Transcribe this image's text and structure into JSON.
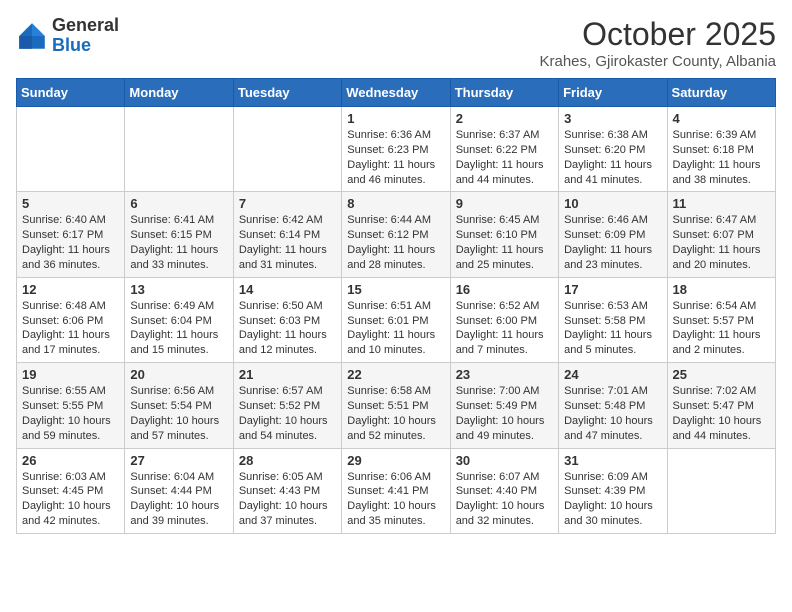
{
  "header": {
    "logo_general": "General",
    "logo_blue": "Blue",
    "month": "October 2025",
    "location": "Krahes, Gjirokaster County, Albania"
  },
  "weekdays": [
    "Sunday",
    "Monday",
    "Tuesday",
    "Wednesday",
    "Thursday",
    "Friday",
    "Saturday"
  ],
  "weeks": [
    [
      {
        "day": "",
        "info": ""
      },
      {
        "day": "",
        "info": ""
      },
      {
        "day": "",
        "info": ""
      },
      {
        "day": "1",
        "info": "Sunrise: 6:36 AM\nSunset: 6:23 PM\nDaylight: 11 hours\nand 46 minutes."
      },
      {
        "day": "2",
        "info": "Sunrise: 6:37 AM\nSunset: 6:22 PM\nDaylight: 11 hours\nand 44 minutes."
      },
      {
        "day": "3",
        "info": "Sunrise: 6:38 AM\nSunset: 6:20 PM\nDaylight: 11 hours\nand 41 minutes."
      },
      {
        "day": "4",
        "info": "Sunrise: 6:39 AM\nSunset: 6:18 PM\nDaylight: 11 hours\nand 38 minutes."
      }
    ],
    [
      {
        "day": "5",
        "info": "Sunrise: 6:40 AM\nSunset: 6:17 PM\nDaylight: 11 hours\nand 36 minutes."
      },
      {
        "day": "6",
        "info": "Sunrise: 6:41 AM\nSunset: 6:15 PM\nDaylight: 11 hours\nand 33 minutes."
      },
      {
        "day": "7",
        "info": "Sunrise: 6:42 AM\nSunset: 6:14 PM\nDaylight: 11 hours\nand 31 minutes."
      },
      {
        "day": "8",
        "info": "Sunrise: 6:44 AM\nSunset: 6:12 PM\nDaylight: 11 hours\nand 28 minutes."
      },
      {
        "day": "9",
        "info": "Sunrise: 6:45 AM\nSunset: 6:10 PM\nDaylight: 11 hours\nand 25 minutes."
      },
      {
        "day": "10",
        "info": "Sunrise: 6:46 AM\nSunset: 6:09 PM\nDaylight: 11 hours\nand 23 minutes."
      },
      {
        "day": "11",
        "info": "Sunrise: 6:47 AM\nSunset: 6:07 PM\nDaylight: 11 hours\nand 20 minutes."
      }
    ],
    [
      {
        "day": "12",
        "info": "Sunrise: 6:48 AM\nSunset: 6:06 PM\nDaylight: 11 hours\nand 17 minutes."
      },
      {
        "day": "13",
        "info": "Sunrise: 6:49 AM\nSunset: 6:04 PM\nDaylight: 11 hours\nand 15 minutes."
      },
      {
        "day": "14",
        "info": "Sunrise: 6:50 AM\nSunset: 6:03 PM\nDaylight: 11 hours\nand 12 minutes."
      },
      {
        "day": "15",
        "info": "Sunrise: 6:51 AM\nSunset: 6:01 PM\nDaylight: 11 hours\nand 10 minutes."
      },
      {
        "day": "16",
        "info": "Sunrise: 6:52 AM\nSunset: 6:00 PM\nDaylight: 11 hours\nand 7 minutes."
      },
      {
        "day": "17",
        "info": "Sunrise: 6:53 AM\nSunset: 5:58 PM\nDaylight: 11 hours\nand 5 minutes."
      },
      {
        "day": "18",
        "info": "Sunrise: 6:54 AM\nSunset: 5:57 PM\nDaylight: 11 hours\nand 2 minutes."
      }
    ],
    [
      {
        "day": "19",
        "info": "Sunrise: 6:55 AM\nSunset: 5:55 PM\nDaylight: 10 hours\nand 59 minutes."
      },
      {
        "day": "20",
        "info": "Sunrise: 6:56 AM\nSunset: 5:54 PM\nDaylight: 10 hours\nand 57 minutes."
      },
      {
        "day": "21",
        "info": "Sunrise: 6:57 AM\nSunset: 5:52 PM\nDaylight: 10 hours\nand 54 minutes."
      },
      {
        "day": "22",
        "info": "Sunrise: 6:58 AM\nSunset: 5:51 PM\nDaylight: 10 hours\nand 52 minutes."
      },
      {
        "day": "23",
        "info": "Sunrise: 7:00 AM\nSunset: 5:49 PM\nDaylight: 10 hours\nand 49 minutes."
      },
      {
        "day": "24",
        "info": "Sunrise: 7:01 AM\nSunset: 5:48 PM\nDaylight: 10 hours\nand 47 minutes."
      },
      {
        "day": "25",
        "info": "Sunrise: 7:02 AM\nSunset: 5:47 PM\nDaylight: 10 hours\nand 44 minutes."
      }
    ],
    [
      {
        "day": "26",
        "info": "Sunrise: 6:03 AM\nSunset: 4:45 PM\nDaylight: 10 hours\nand 42 minutes."
      },
      {
        "day": "27",
        "info": "Sunrise: 6:04 AM\nSunset: 4:44 PM\nDaylight: 10 hours\nand 39 minutes."
      },
      {
        "day": "28",
        "info": "Sunrise: 6:05 AM\nSunset: 4:43 PM\nDaylight: 10 hours\nand 37 minutes."
      },
      {
        "day": "29",
        "info": "Sunrise: 6:06 AM\nSunset: 4:41 PM\nDaylight: 10 hours\nand 35 minutes."
      },
      {
        "day": "30",
        "info": "Sunrise: 6:07 AM\nSunset: 4:40 PM\nDaylight: 10 hours\nand 32 minutes."
      },
      {
        "day": "31",
        "info": "Sunrise: 6:09 AM\nSunset: 4:39 PM\nDaylight: 10 hours\nand 30 minutes."
      },
      {
        "day": "",
        "info": ""
      }
    ]
  ]
}
